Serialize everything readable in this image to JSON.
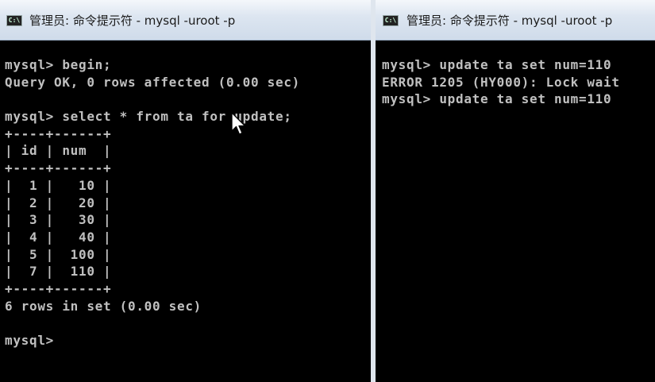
{
  "left_window": {
    "title": "管理员: 命令提示符 - mysql  -uroot -p",
    "icon_label": "C:\\",
    "lines": [
      "mysql> begin;",
      "Query OK, 0 rows affected (0.00 sec)",
      "",
      "mysql> select * from ta for update;",
      "+----+------+",
      "| id | num  |",
      "+----+------+",
      "|  1 |   10 |",
      "|  2 |   20 |",
      "|  3 |   30 |",
      "|  4 |   40 |",
      "|  5 |  100 |",
      "|  7 |  110 |",
      "+----+------+",
      "6 rows in set (0.00 sec)",
      "",
      "mysql>"
    ]
  },
  "right_window": {
    "title": "管理员: 命令提示符 - mysql  -uroot -p",
    "icon_label": "C:\\",
    "lines": [
      "mysql> update ta set num=110",
      "ERROR 1205 (HY000): Lock wait",
      "mysql> update ta set num=110"
    ]
  },
  "colors": {
    "console_bg": "#000000",
    "console_text": "#c0c0c0"
  },
  "icons": [
    "console-app-icon",
    "mouse-pointer-icon"
  ]
}
